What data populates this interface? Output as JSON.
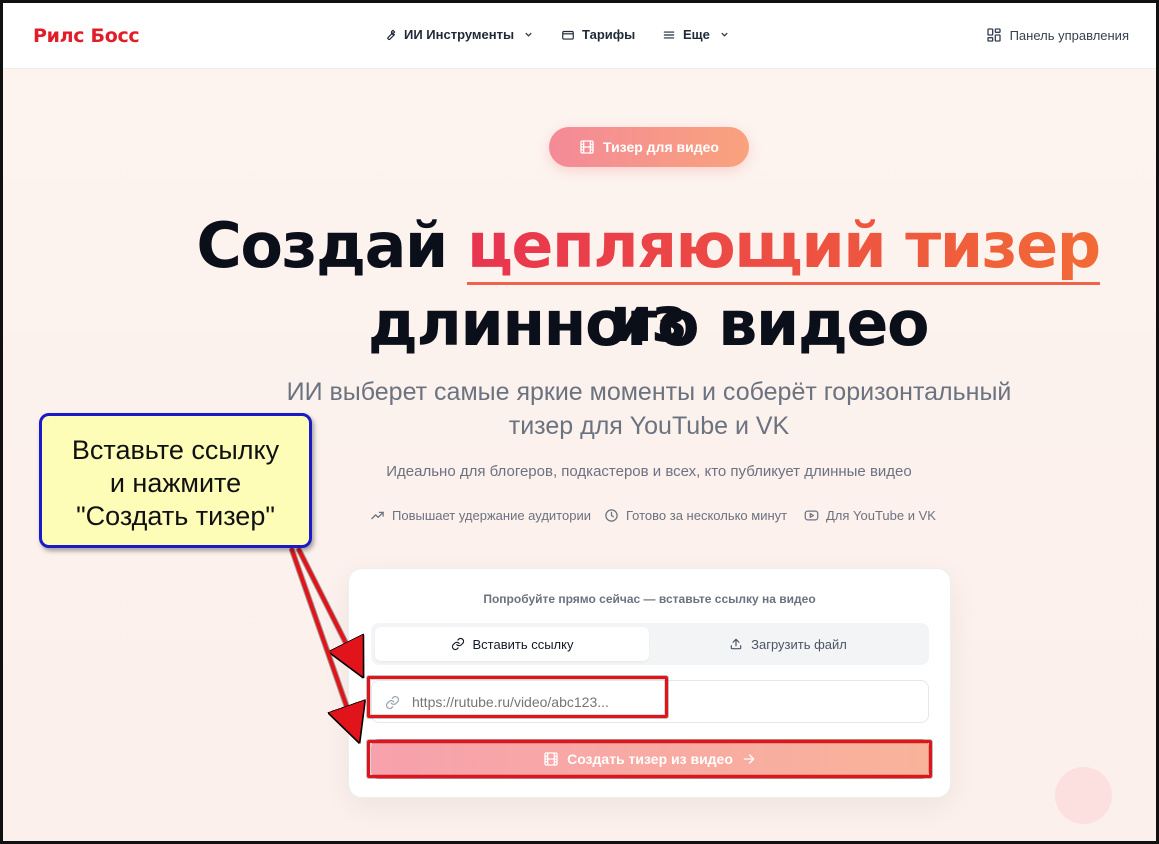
{
  "header": {
    "logo": "Рилс Босс",
    "nav": {
      "tools": "ИИ Инструменты",
      "pricing": "Тарифы",
      "more": "Еще"
    },
    "dashboard": "Панель управления"
  },
  "hero": {
    "badge": "Тизер для видео",
    "headline_pre": "Создай ",
    "headline_accent": "цепляющий тизер",
    "headline_post": " из",
    "headline_line2": "длинного видео",
    "subtitle_line1": "ИИ выберет самые яркие моменты и соберёт горизонтальный",
    "subtitle_line2": "тизер для YouTube и VK",
    "description": "Идеально для блогеров, подкастеров и всех, кто публикует длинные видео",
    "features": [
      "Повышает удержание аудитории",
      "Готово за несколько минут",
      "Для YouTube и VK"
    ]
  },
  "card": {
    "title": "Попробуйте прямо сейчас — вставьте ссылку на видео",
    "tabs": [
      "Вставить ссылку",
      "Загрузить файл"
    ],
    "input_placeholder": "https://rutube.ru/video/abc123...",
    "cta": "Создать тизер из видео"
  },
  "annotation": {
    "line1": "Вставьте ссылку",
    "line2": "и нажмите",
    "line3": "\"Создать тизер\""
  },
  "colors": {
    "brand": "#e11d2a",
    "accent_start": "#e8344f",
    "accent_end": "#f26a36",
    "highlight": "#e2141b",
    "callout_bg": "#fdfdb8",
    "callout_border": "#1a1ac8"
  }
}
